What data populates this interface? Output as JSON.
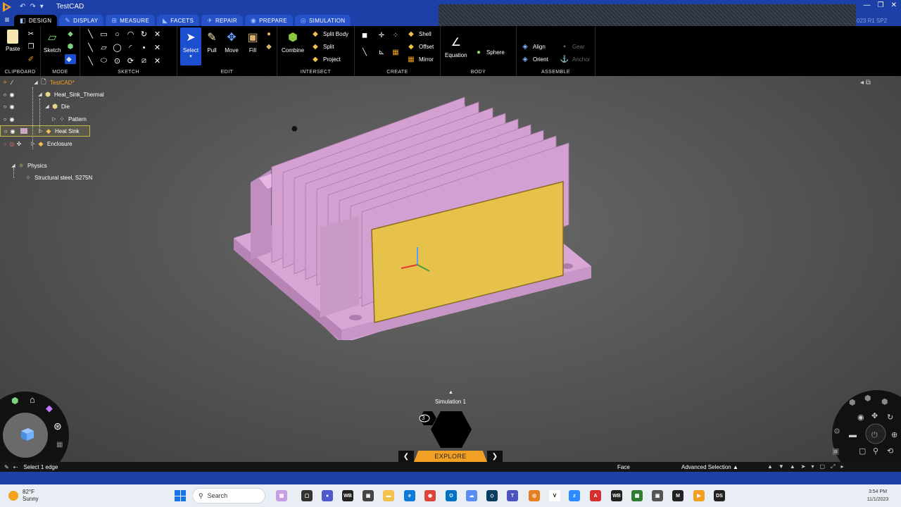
{
  "titlebar": {
    "app_title": "TestCAD",
    "version_text": "023 R1 SP2"
  },
  "tabs": [
    {
      "label": "Design",
      "active": true
    },
    {
      "label": "Display",
      "active": false
    },
    {
      "label": "Measure",
      "active": false
    },
    {
      "label": "Facets",
      "active": false
    },
    {
      "label": "Repair",
      "active": false
    },
    {
      "label": "Prepare",
      "active": false
    },
    {
      "label": "Simulation",
      "active": false
    }
  ],
  "ribbon": {
    "clipboard": {
      "label": "Clipboard",
      "paste": "Paste"
    },
    "mode": {
      "label": "Mode",
      "sketch": "Sketch"
    },
    "sketch": {
      "label": "Sketch"
    },
    "edit": {
      "label": "Edit",
      "select": "Select",
      "pull": "Pull",
      "move": "Move",
      "fill": "Fill"
    },
    "intersect": {
      "label": "Intersect",
      "combine": "Combine",
      "split_body": "Split Body",
      "split": "Split",
      "project": "Project"
    },
    "create": {
      "label": "Create",
      "shell": "Shell",
      "offset": "Offset",
      "mirror": "Mirror"
    },
    "body": {
      "label": "Body",
      "equation": "Equation",
      "sphere": "Sphere"
    },
    "assemble": {
      "label": "Assemble",
      "align": "Align",
      "orient": "Orient",
      "gear": "Gear",
      "anchor": "Anchor"
    }
  },
  "tree": {
    "root": "TestCAD*",
    "items": [
      "Heat_Sink_Thermal",
      "Die",
      "Pattern",
      "Heat Sink",
      "Enclosure"
    ],
    "physics": "Physics",
    "material": "Structural steel, S275N"
  },
  "simulation": {
    "label": "Simulation 1",
    "badge": "3",
    "explore": "Explore"
  },
  "statusbar": {
    "message": "Select 1 edge",
    "selection_type": "Face",
    "advanced_selection": "Advanced Selection"
  },
  "taskbar": {
    "temperature": "82°F",
    "condition": "Sunny",
    "search_placeholder": "Search",
    "time": "3:54 PM",
    "date": "11/1/2023"
  },
  "colors": {
    "heatsink": "#d9a6d6",
    "die": "#e6c24a",
    "titlebar": "#1c3fa8",
    "explore": "#f2a024"
  }
}
